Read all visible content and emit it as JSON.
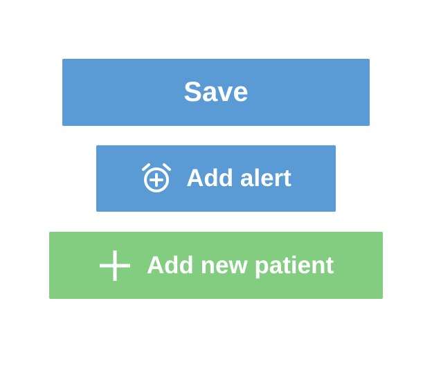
{
  "buttons": {
    "save": {
      "label": "Save",
      "color": "#5b9bd5"
    },
    "add_alert": {
      "label": "Add alert",
      "icon": "alarm-add-icon",
      "color": "#5b9bd5"
    },
    "add_patient": {
      "label": "Add new patient",
      "icon": "plus-icon",
      "color": "#82cd80"
    }
  }
}
